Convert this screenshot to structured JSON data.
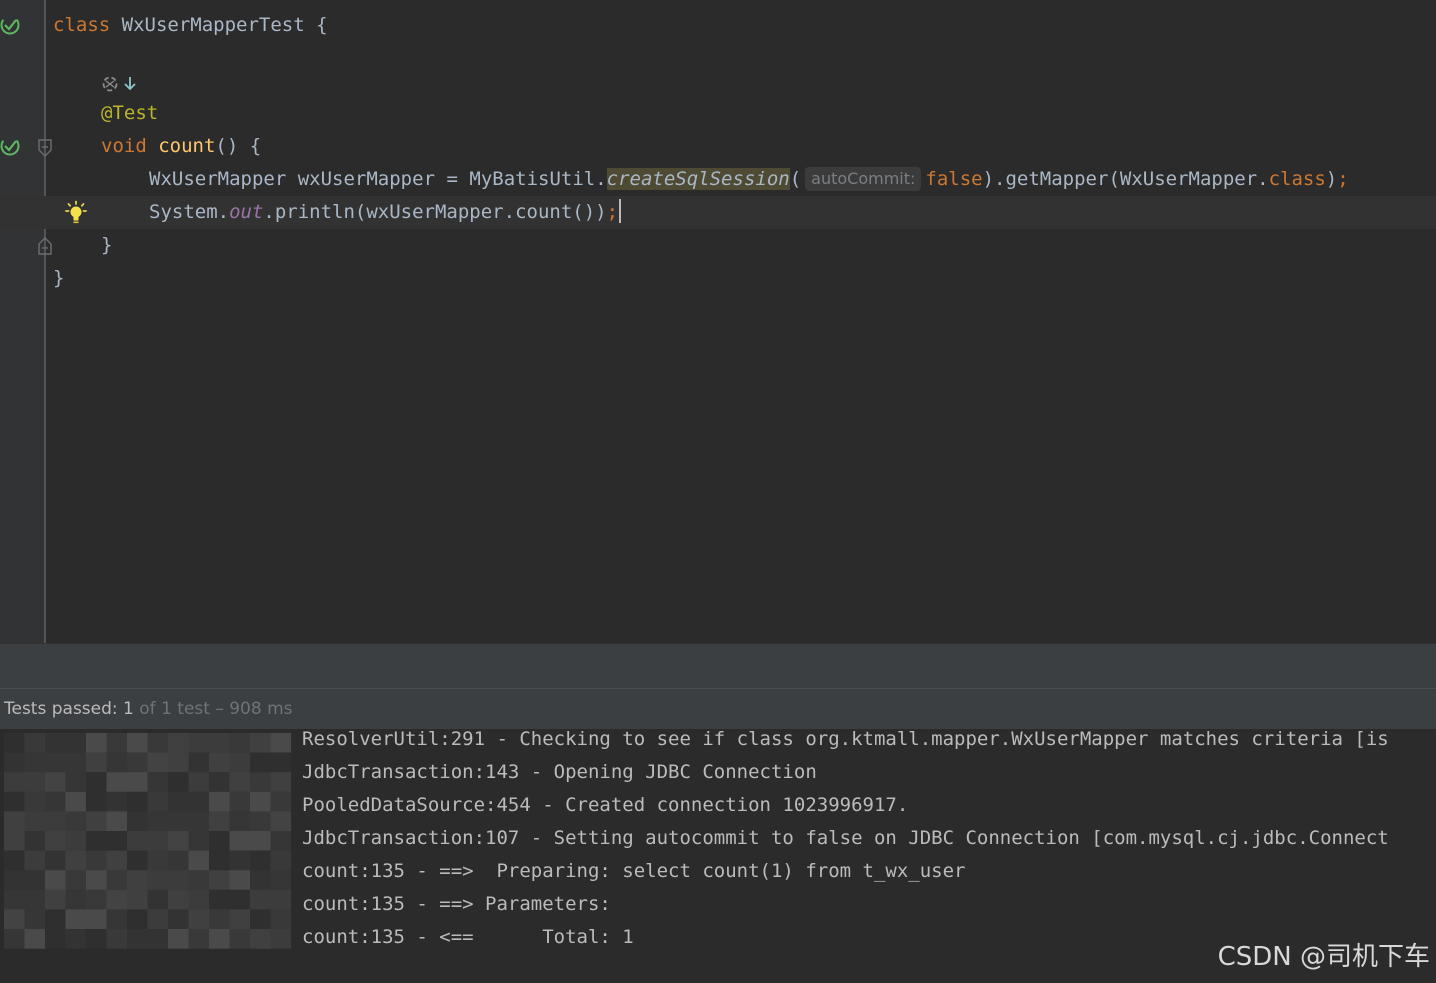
{
  "editor": {
    "lines": [
      {
        "kw": "class",
        "name": "WxUserMapperTest",
        "brace": "{"
      },
      {
        "annotation": "@Test"
      },
      {
        "kw": "void",
        "method": "count",
        "rest": "() {"
      },
      {
        "type": "WxUserMapper",
        "var": "wxUserMapper",
        "eq": "=",
        "cls": "MyBatisUtil",
        "dot": ".",
        "call": "createSqlSession",
        "paren_open": "(",
        "hint": "autoCommit:",
        "arg": "false",
        "mid": ").getMapper(WxUserMapper.",
        "class_kw": "class",
        "close": ")",
        "semi": ";"
      },
      {
        "pre": "System.",
        "field": "out",
        "post": ".println(wxUserMapper.count())",
        "semi": ";"
      },
      {
        "text": "}"
      },
      {
        "text": "}"
      }
    ]
  },
  "test_status": {
    "passed_label": "Tests passed:",
    "passed_count": "1",
    "rest": "of 1 test – 908 ms"
  },
  "console": {
    "lines": [
      "ResolverUtil:291 - Checking to see if class org.ktmall.mapper.WxUserMapper matches criteria [is",
      "JdbcTransaction:143 - Opening JDBC Connection",
      "PooledDataSource:454 - Created connection 1023996917.",
      "JdbcTransaction:107 - Setting autocommit to false on JDBC Connection [com.mysql.cj.jdbc.Connect",
      "count:135 - ==>  Preparing: select count(1) from t_wx_user",
      "count:135 - ==> Parameters: ",
      "count:135 - <==      Total: 1"
    ]
  },
  "watermark": "CSDN @司机下车",
  "colors": {
    "keyword": "#cc7832",
    "method_decl": "#ffc66d",
    "annotation": "#bbb529",
    "field": "#9876aa",
    "default_text": "#a9b7c6",
    "test_pass": "#5fb85f"
  },
  "icons": [
    "test-passed-icon",
    "test-passed-icon",
    "fold-marker-icon",
    "lightbulb-icon",
    "implementation-arrow-icon"
  ]
}
